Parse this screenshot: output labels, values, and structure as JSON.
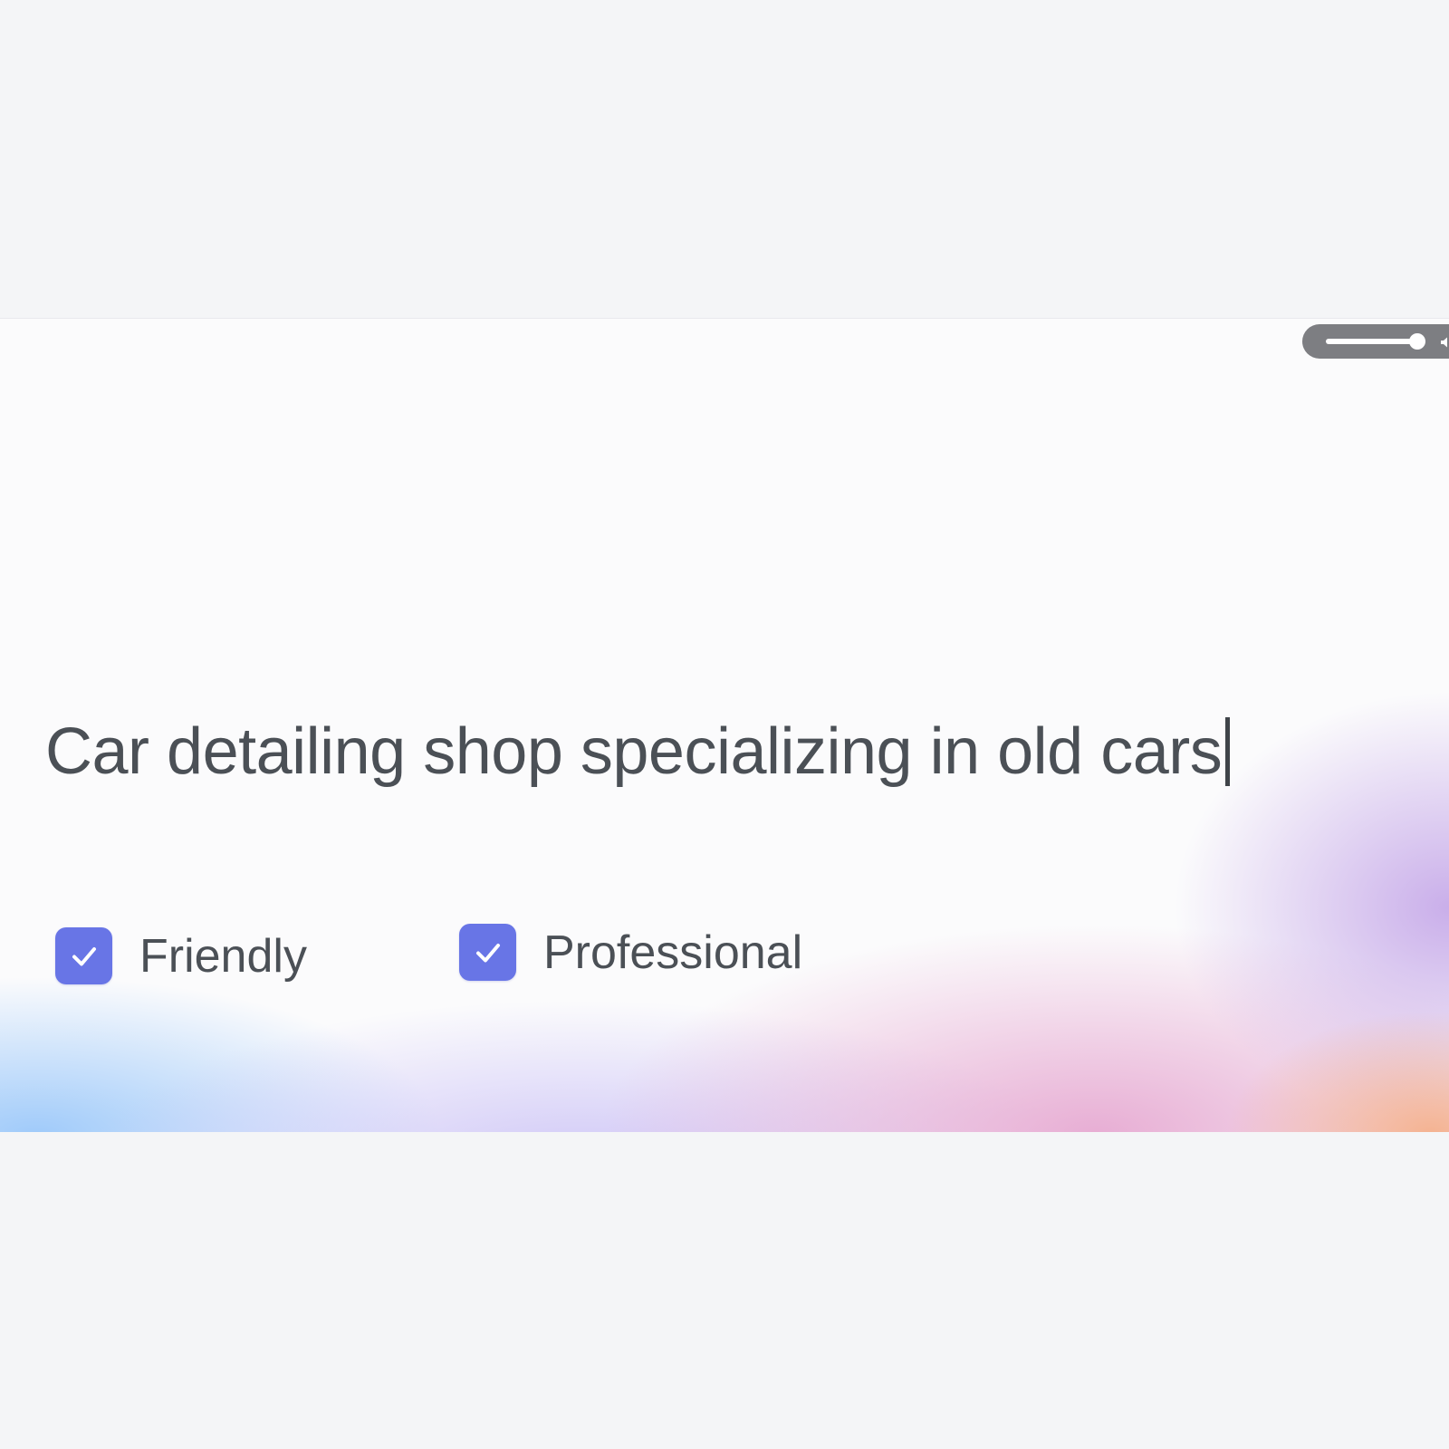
{
  "prompt": {
    "text": "Car detailing shop specializing in old cars"
  },
  "volume": {
    "level": 0.92,
    "icon": "speaker-icon"
  },
  "tones": [
    {
      "label": "Friendly",
      "checked": true,
      "icon": "checkmark-icon"
    },
    {
      "label": "Professional",
      "checked": true,
      "icon": "checkmark-icon"
    }
  ],
  "colors": {
    "text": "#4b5056",
    "checkbox": "#6875e6",
    "background": "#f4f5f7",
    "slider_pill": "#7d7e82"
  }
}
